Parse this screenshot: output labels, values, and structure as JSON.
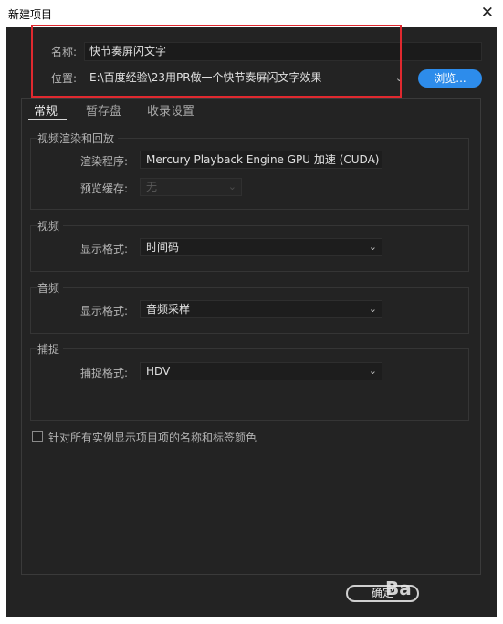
{
  "window": {
    "title": "新建项目",
    "close_glyph": "✕"
  },
  "name_row": {
    "label": "名称:",
    "value": "快节奏屏闪文字"
  },
  "location_row": {
    "label": "位置:",
    "value": "E:\\百度经验\\23用PR做一个快节奏屏闪文字效果",
    "browse_label": "浏览..."
  },
  "tabs": [
    {
      "label": "常规",
      "active": true
    },
    {
      "label": "暂存盘",
      "active": false
    },
    {
      "label": "收录设置",
      "active": false
    }
  ],
  "video_render": {
    "title": "视频渲染和回放",
    "renderer_label": "渲染程序:",
    "renderer_value": "Mercury Playback Engine GPU 加速 (CUDA)",
    "preview_cache_label": "预览缓存:",
    "preview_cache_value": "无"
  },
  "video": {
    "title": "视频",
    "format_label": "显示格式:",
    "format_value": "时间码"
  },
  "audio": {
    "title": "音频",
    "format_label": "显示格式:",
    "format_value": "音频采样"
  },
  "capture": {
    "title": "捕捉",
    "format_label": "捕捉格式:",
    "format_value": "HDV"
  },
  "checkbox": {
    "label": "针对所有实例显示项目项的名称和标签颜色",
    "checked": false
  },
  "footer": {
    "ok_label": "确定",
    "watermark": "Ba"
  },
  "colors": {
    "accent": "#2d8ceb",
    "highlight_box": "#e0292f",
    "background": "#232323"
  },
  "icons": {
    "dropdown": "chevron-down-icon",
    "close": "close-icon"
  }
}
